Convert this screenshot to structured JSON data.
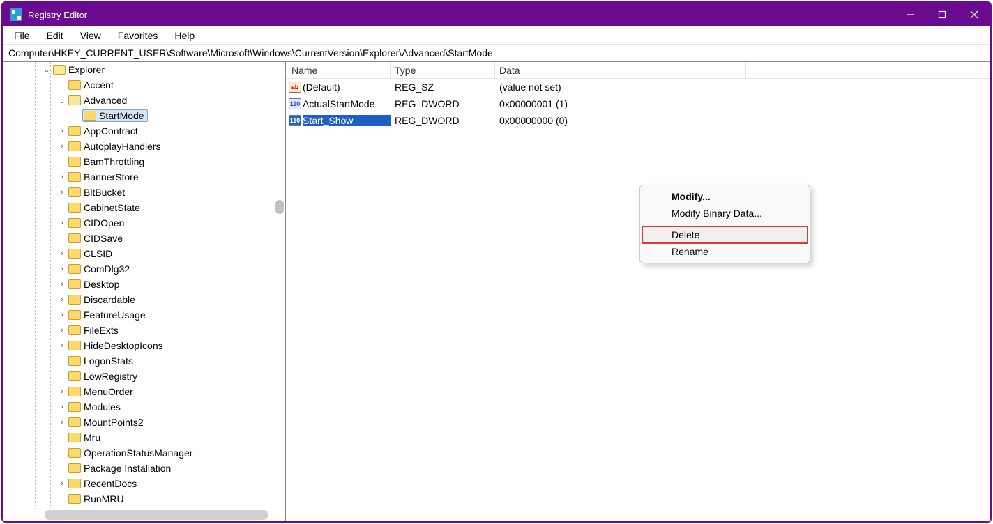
{
  "title": "Registry Editor",
  "menu": {
    "file": "File",
    "edit": "Edit",
    "view": "View",
    "favorites": "Favorites",
    "help": "Help"
  },
  "address": "Computer\\HKEY_CURRENT_USER\\Software\\Microsoft\\Windows\\CurrentVersion\\Explorer\\Advanced\\StartMode",
  "tree": {
    "explorer": "Explorer",
    "accent": "Accent",
    "advanced": "Advanced",
    "startmode": "StartMode",
    "items": [
      {
        "label": "AppContract",
        "arrow": true
      },
      {
        "label": "AutoplayHandlers",
        "arrow": true
      },
      {
        "label": "BamThrottling",
        "arrow": false
      },
      {
        "label": "BannerStore",
        "arrow": true
      },
      {
        "label": "BitBucket",
        "arrow": true
      },
      {
        "label": "CabinetState",
        "arrow": false
      },
      {
        "label": "CIDOpen",
        "arrow": true
      },
      {
        "label": "CIDSave",
        "arrow": false
      },
      {
        "label": "CLSID",
        "arrow": true
      },
      {
        "label": "ComDlg32",
        "arrow": true
      },
      {
        "label": "Desktop",
        "arrow": true
      },
      {
        "label": "Discardable",
        "arrow": true
      },
      {
        "label": "FeatureUsage",
        "arrow": true
      },
      {
        "label": "FileExts",
        "arrow": true
      },
      {
        "label": "HideDesktopIcons",
        "arrow": true
      },
      {
        "label": "LogonStats",
        "arrow": false
      },
      {
        "label": "LowRegistry",
        "arrow": false
      },
      {
        "label": "MenuOrder",
        "arrow": true
      },
      {
        "label": "Modules",
        "arrow": true
      },
      {
        "label": "MountPoints2",
        "arrow": true
      },
      {
        "label": "Mru",
        "arrow": false
      },
      {
        "label": "OperationStatusManager",
        "arrow": false
      },
      {
        "label": "Package Installation",
        "arrow": false
      },
      {
        "label": "RecentDocs",
        "arrow": true
      },
      {
        "label": "RunMRU",
        "arrow": false
      }
    ]
  },
  "list": {
    "headers": {
      "name": "Name",
      "type": "Type",
      "data": "Data"
    },
    "rows": [
      {
        "icon": "sz",
        "name": "(Default)",
        "type": "REG_SZ",
        "data": "(value not set)",
        "selected": false
      },
      {
        "icon": "dw",
        "name": "ActualStartMode",
        "type": "REG_DWORD",
        "data": "0x00000001 (1)",
        "selected": false
      },
      {
        "icon": "dw",
        "name": "Start_Show",
        "type": "REG_DWORD",
        "data": "0x00000000 (0)",
        "selected": true
      }
    ]
  },
  "context": {
    "modify": "Modify...",
    "modify_binary": "Modify Binary Data...",
    "delete": "Delete",
    "rename": "Rename"
  }
}
